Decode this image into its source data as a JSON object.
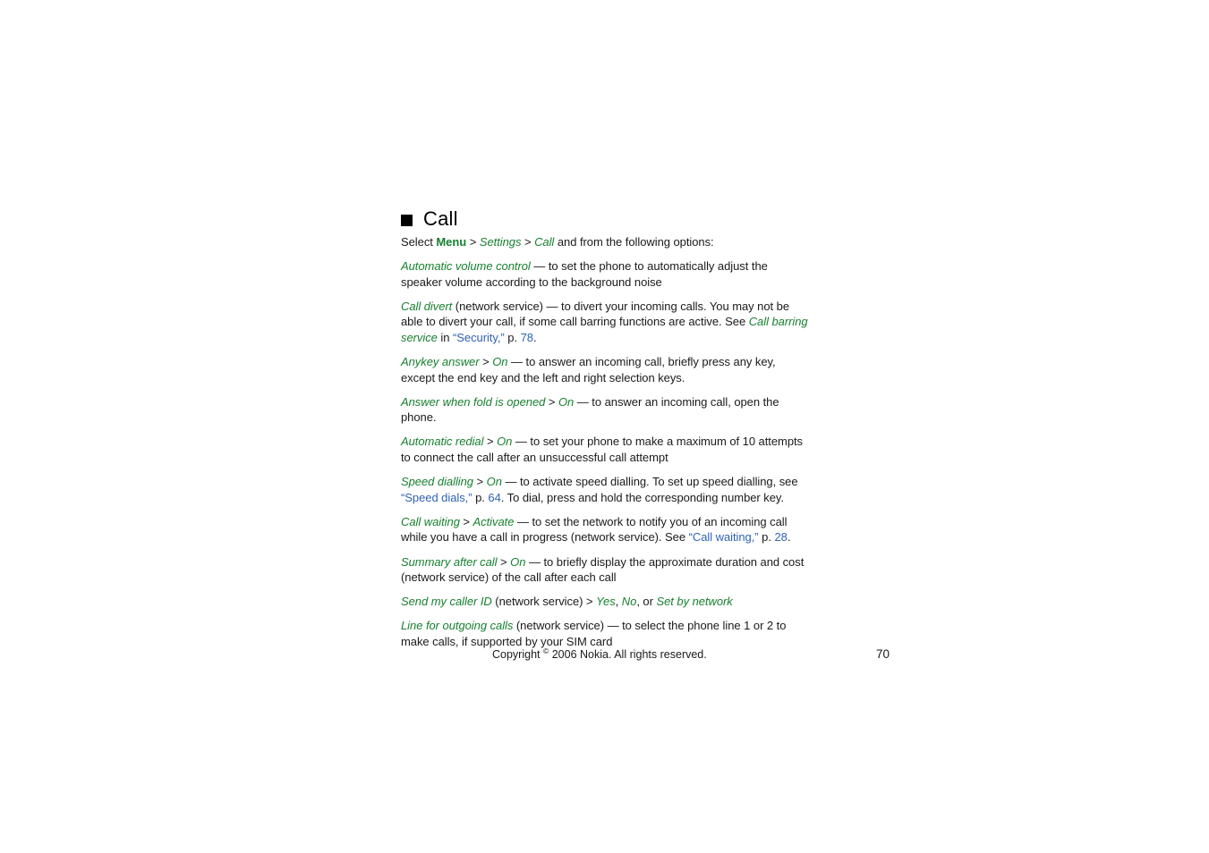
{
  "document": {
    "heading": {
      "bullet": "filled-square",
      "title": "Call"
    },
    "intro": {
      "select_label": "Select ",
      "menu": "Menu",
      "sep1": " > ",
      "settings": "Settings",
      "sep2": " > ",
      "call": "Call",
      "tail": " and from the following options:"
    },
    "paragraphs": [
      {
        "id": "automatic-volume-control",
        "term": "Automatic volume control",
        "text": " — to set the phone to automatically adjust the speaker volume according to the background noise"
      },
      {
        "id": "call-divert",
        "term": "Call divert",
        "text_a": " (network service) — to divert your incoming calls. You may not be able to divert your call, if some call barring functions are active. See ",
        "ref_term": "Call barring service",
        "text_b": " in ",
        "link": "“Security,”",
        "text_c": " p. ",
        "page": "78",
        "text_d": "."
      },
      {
        "id": "anykey-answer",
        "term": "Anykey answer",
        "sep": " > ",
        "value": "On",
        "text": " — to answer an incoming call, briefly press any key, except the end key and the left and right selection keys."
      },
      {
        "id": "answer-when-fold-is-opened",
        "term": "Answer when fold is opened",
        "sep": " > ",
        "value": "On",
        "text": " — to answer an incoming call, open the phone."
      },
      {
        "id": "automatic-redial",
        "term": "Automatic redial",
        "sep": " > ",
        "value": "On",
        "text": " — to set your phone to make a maximum of 10 attempts to connect the call after an unsuccessful call attempt"
      },
      {
        "id": "speed-dialling",
        "term": "Speed dialling",
        "sep": " > ",
        "value": "On",
        "text_a": " — to activate speed dialling. To set up speed dialling, see ",
        "link": "“Speed dials,”",
        "text_b": " p. ",
        "page": "64",
        "text_c": ". To dial, press and hold the corresponding number key."
      },
      {
        "id": "call-waiting",
        "term": "Call waiting",
        "sep": " > ",
        "value": "Activate",
        "text_a": " — to set the network to notify you of an incoming call while you have a call in progress (network service). See ",
        "link": "“Call waiting,”",
        "text_b": " p. ",
        "page": "28",
        "text_c": "."
      },
      {
        "id": "summary-after-call",
        "term": "Summary after call",
        "sep": " > ",
        "value": "On",
        "text": " — to briefly display the approximate duration and cost (network service) of the call after each call"
      },
      {
        "id": "send-my-caller-id",
        "term": "Send my caller ID",
        "text_a": " (network service) > ",
        "value1": "Yes",
        "comma1": ", ",
        "value2": "No",
        "comma2": ", or ",
        "value3": "Set by network"
      },
      {
        "id": "line-for-outgoing-calls",
        "term": "Line for outgoing calls",
        "text": " (network service) — to select the phone line 1 or 2 to make calls, if supported by your SIM card"
      }
    ],
    "footer": {
      "copyright_pre": "Copyright ",
      "copyright_symbol": "©",
      "copyright_post": " 2006 Nokia. All rights reserved.",
      "page_number": "70"
    }
  },
  "colors": {
    "green": "#17802f",
    "blue": "#2f62b4",
    "text": "#1a1a1a",
    "background": "#ffffff"
  }
}
